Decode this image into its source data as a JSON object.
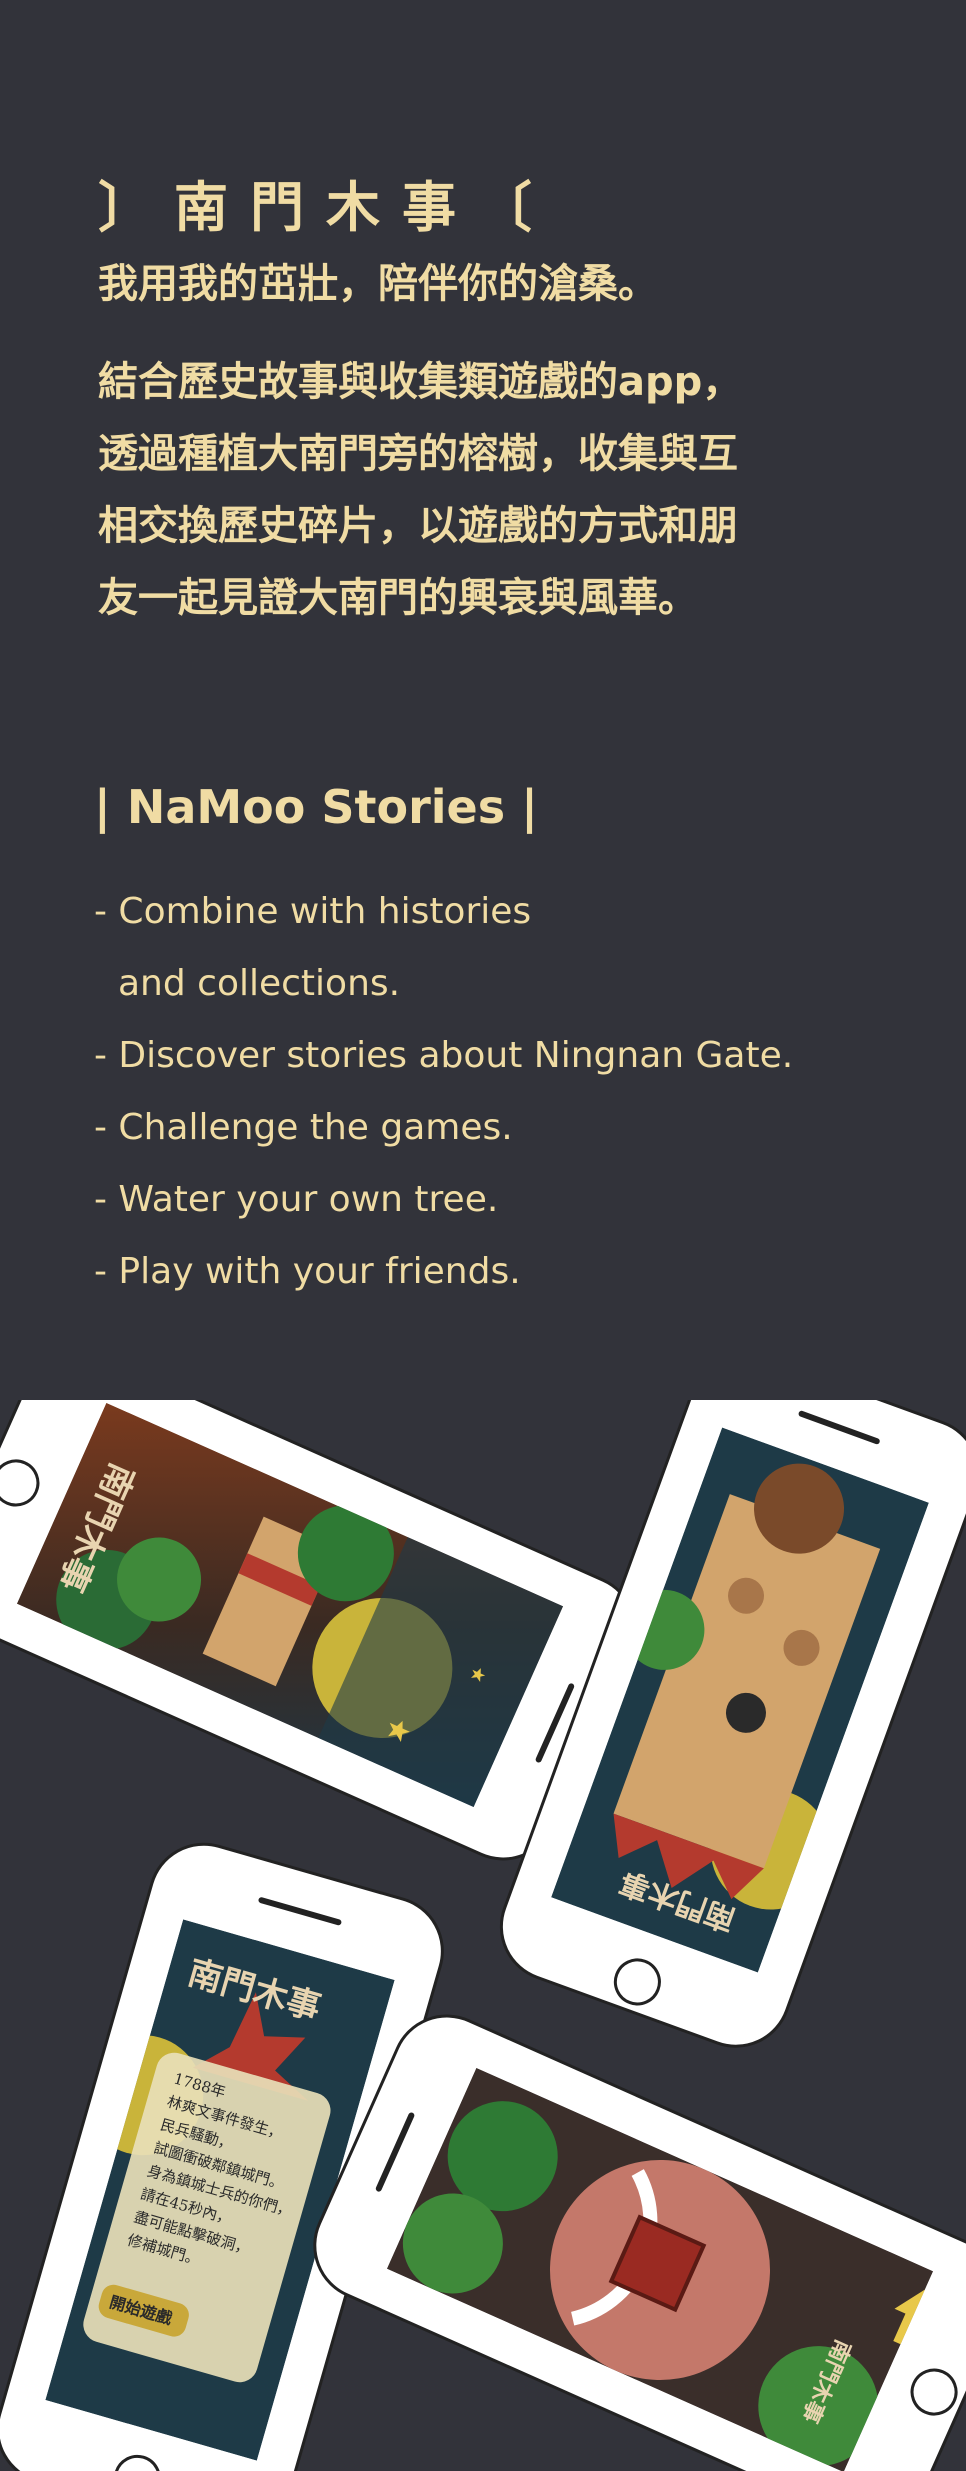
{
  "intro": {
    "title": "〕南門木事〔",
    "tagline": "我用我的茁壯，陪伴你的滄桑。",
    "description_lines": [
      "結合歷史故事與收集類遊戲的app，",
      "透過種植大南門旁的榕樹，收集與互",
      "相交換歷史碎片，以遊戲的方式和朋",
      "友一起見證大南門的興衰與風華。"
    ]
  },
  "english": {
    "title": "| NaMoo  Stories |",
    "features": [
      {
        "line1": "- Combine with histories",
        "line2": "and collections."
      },
      {
        "line1": "- Discover stories about Ningnan Gate."
      },
      {
        "line1": "- Challenge the games."
      },
      {
        "line1": "- Water your own tree."
      },
      {
        "line1": "- Play with your friends."
      }
    ]
  },
  "mockups": {
    "logo_text": "南門木事",
    "story_lines": [
      "1788年",
      "林爽文事件發生，",
      "民兵騷動，",
      "試圖衝破鄰鎮城門。",
      "身為鎮城士兵的你們，",
      "請在45秒內，",
      "盡可能點擊破洞，",
      "修補城門。"
    ],
    "start_button": "開始遊戲"
  },
  "colors": {
    "background": "#32333a",
    "accent": "#f0dca4",
    "phone_body": "#ffffff",
    "night_sky": "#1e3a47",
    "tree_green": "#3f8a3a",
    "moon": "#c9b43a",
    "wall_tan": "#d2a46c"
  }
}
